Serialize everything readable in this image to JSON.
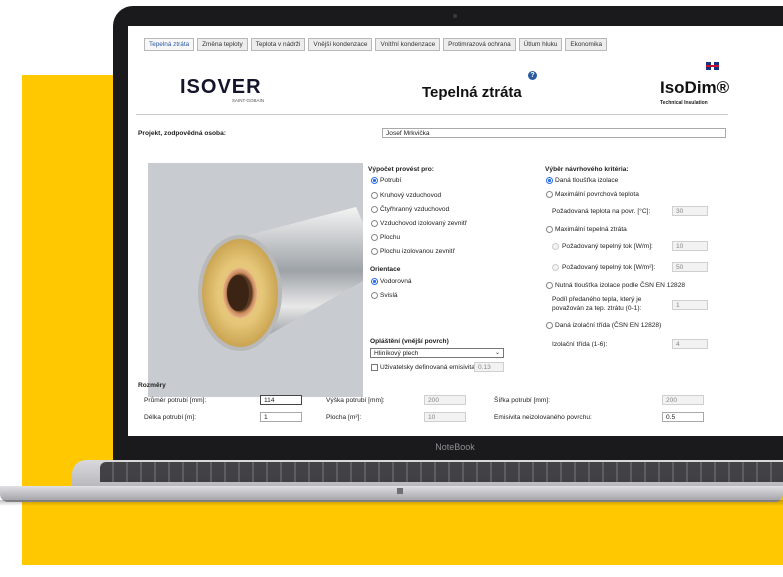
{
  "tabs": [
    "Tepelná ztráta",
    "Změna teploty",
    "Teplota v nádrži",
    "Vnější kondenzace",
    "Vnitřní kondenzace",
    "Protimrazová ochrana",
    "Útlum hluku",
    "Ekonomika"
  ],
  "header": {
    "brand": "ISOVER",
    "brand_sub": "SAINT-GOBAIN",
    "title": "Tepelná ztráta",
    "help_icon": "?",
    "product": "IsoDim®",
    "product_sub": "Technical Insulation",
    "language_icon": "uk-flag-icon"
  },
  "project": {
    "label": "Projekt, zodpovědná osoba:",
    "value": "Josef Mrkvička"
  },
  "calc": {
    "heading": "Výpočet provést pro:",
    "options": [
      "Potrubí",
      "Kruhový vzduchovod",
      "Čtyřhranný vzduchovod",
      "Vzduchovod izolovaný zevnitř",
      "Plochu",
      "Plochu izolovanou zevnitř"
    ],
    "selected": 0
  },
  "orientation": {
    "heading": "Orientace",
    "options": [
      "Vodorovná",
      "Svislá"
    ],
    "selected": 0
  },
  "cladding": {
    "heading": "Opláštění (vnější povrch)",
    "value": "Hliníkový plech",
    "checkbox_label": "Uživatelsky definovaná emisivita",
    "emissivity": "0.13"
  },
  "criteria": {
    "heading": "Výběr návrhového kritéria:",
    "opt1": "Daná tloušťka izolace",
    "opt2": "Maximální povrchová teplota",
    "surface_temp_label": "Požadovaná teplota na povr. [°C]:",
    "surface_temp_value": "30",
    "opt3": "Maximální tepelná ztráta",
    "flow_w_label": "Požadovaný tepelný tok [W/m]:",
    "flow_w_value": "10",
    "flow_w2_label": "Požadovaný tepelný tok [W/m²]:",
    "flow_w2_value": "50",
    "opt4": "Nutná tloušťka izolace podle ČSN EN 12828",
    "share_label_1": "Podíl předaného tepla, který je",
    "share_label_2": "považován za tep. ztrátu (0-1):",
    "share_value": "1",
    "opt5": "Daná izolační třída (ČSN EN 12828)",
    "class_label": "Izolační třída (1-6):",
    "class_value": "4",
    "selected": 0
  },
  "dimensions": {
    "heading": "Rozměry",
    "pipe_diameter_label": "Průměr potrubí [mm]:",
    "pipe_diameter_value": "114",
    "pipe_length_label": "Délka potrubí [m]:",
    "pipe_length_value": "1",
    "duct_height_label": "Výška potrubí [mm]:",
    "duct_height_value": "200",
    "area_label": "Plocha [m²]:",
    "area_value": "10",
    "duct_width_label": "Šířka potrubí [mm]:",
    "duct_width_value": "200",
    "emissivity_label": "Emisivita neizolovaného povrchu:",
    "emissivity_value": "0.5"
  },
  "device_label": "NoteBook",
  "colors": {
    "background_accent": "#ffc800",
    "laptop_bezel": "#1a1a1c",
    "link_blue": "#2c5aa0",
    "radio_selected": "#2a6ee8"
  }
}
